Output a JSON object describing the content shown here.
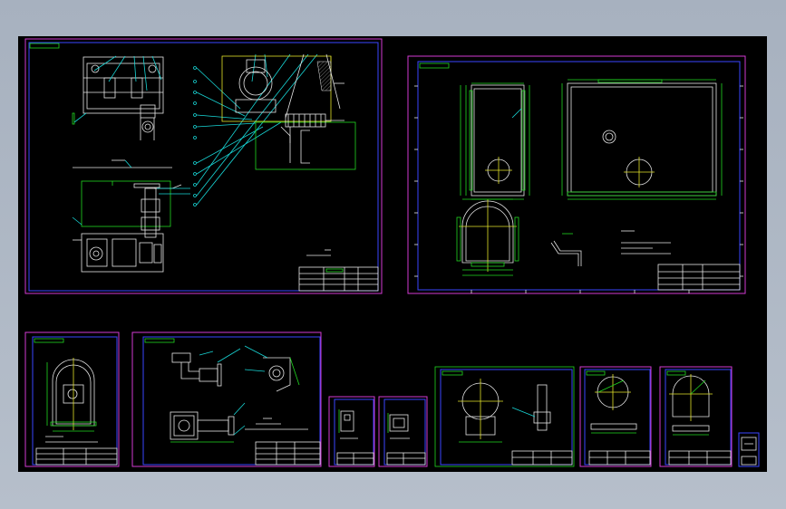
{
  "app": {
    "background": "#000000",
    "chrome": "#aeb7c4"
  },
  "colors": {
    "sheet_border": "#d23ad2",
    "frame": "#3a46ff",
    "geometry": "#e6e6e6",
    "dimension": "#21d821",
    "leader": "#18d6d6",
    "center": "#e3e32a"
  },
  "sheets": [
    {
      "id": "main-assembly"
    },
    {
      "id": "housing-drawing"
    },
    {
      "id": "small-bracket"
    },
    {
      "id": "pipe-assembly"
    },
    {
      "id": "tiny-a"
    },
    {
      "id": "tiny-b"
    },
    {
      "id": "support-drawing"
    },
    {
      "id": "flange-drawing"
    },
    {
      "id": "arch-drawing"
    },
    {
      "id": "icon-sheet"
    }
  ]
}
